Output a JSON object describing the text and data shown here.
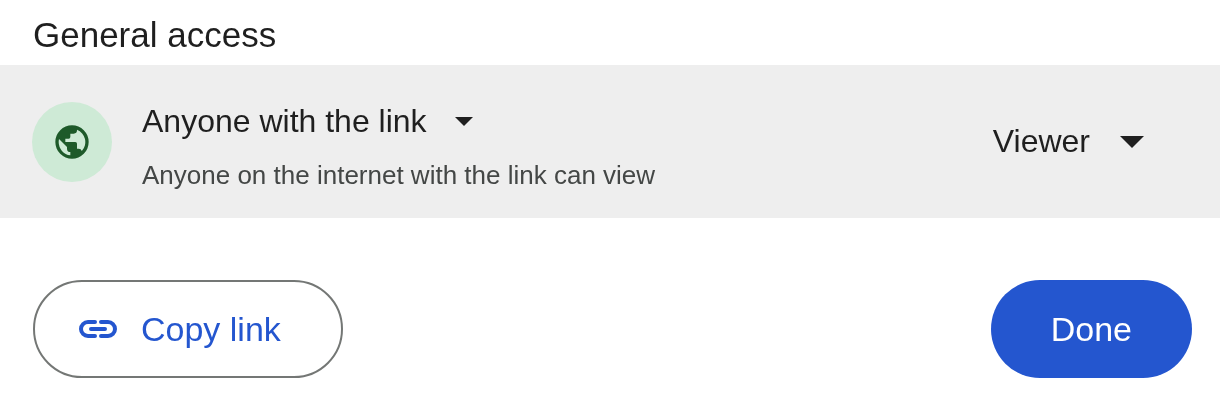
{
  "section_title": "General access",
  "access": {
    "option": "Anyone with the link",
    "description": "Anyone on the internet with the link can view",
    "role": "Viewer"
  },
  "buttons": [
    {
      "kind": "outline",
      "label": "Copy link"
    },
    {
      "kind": "filled",
      "label": "Done"
    }
  ]
}
